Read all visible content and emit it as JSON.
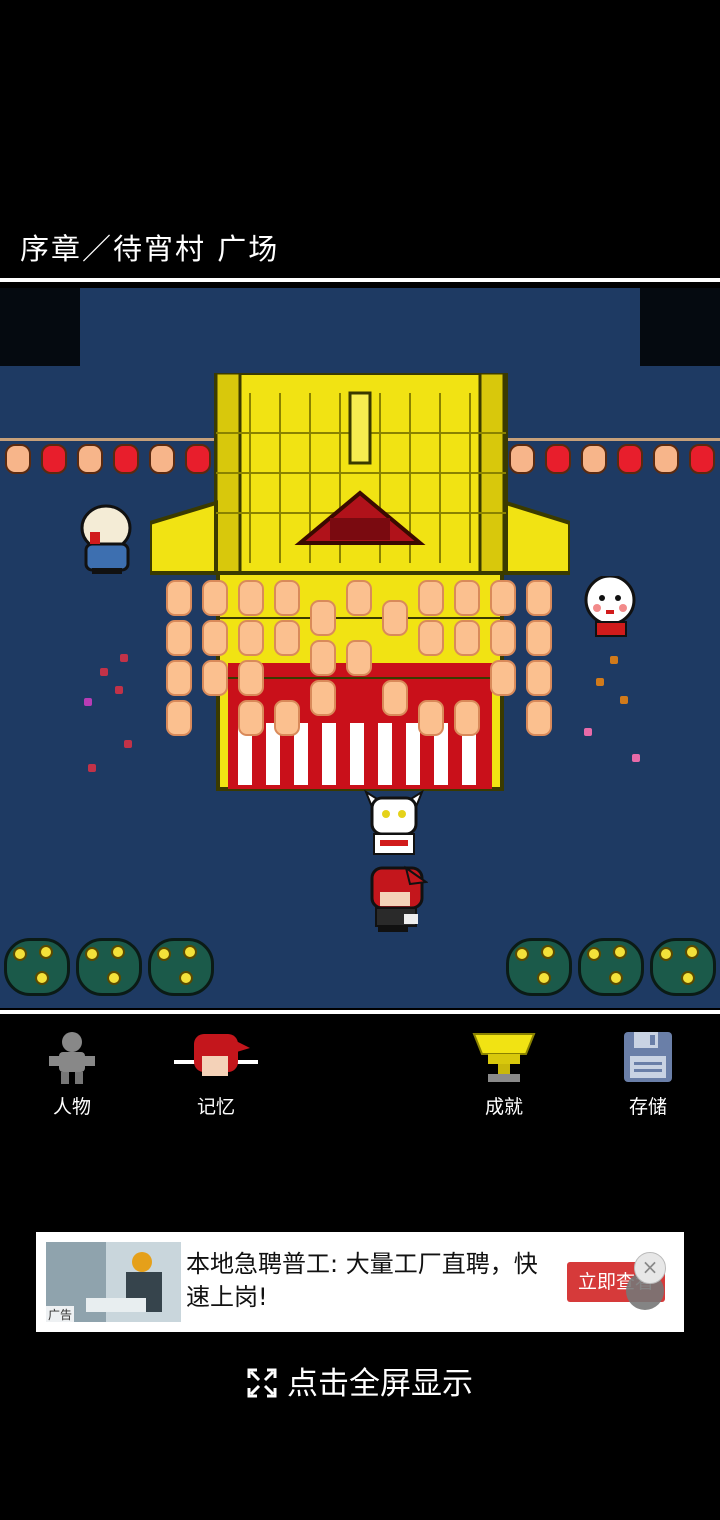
{
  "location": "序章／待宵村 广场",
  "menu": {
    "characters": "人物",
    "memories": "记忆",
    "achievements": "成就",
    "save": "存储"
  },
  "ad": {
    "text": "本地急聘普工: 大量工厂直聘，快速上岗!",
    "button": "立即查看",
    "tag": "广告",
    "close_icon": "close-icon"
  },
  "fullscreen_label": "点击全屏显示",
  "colors": {
    "night_ground": "#1e3a63",
    "shrine_gold": "#f1e313",
    "lantern_red": "#e81e2c",
    "lantern_peach": "#f7b58a",
    "ad_button": "#d63a3a"
  }
}
